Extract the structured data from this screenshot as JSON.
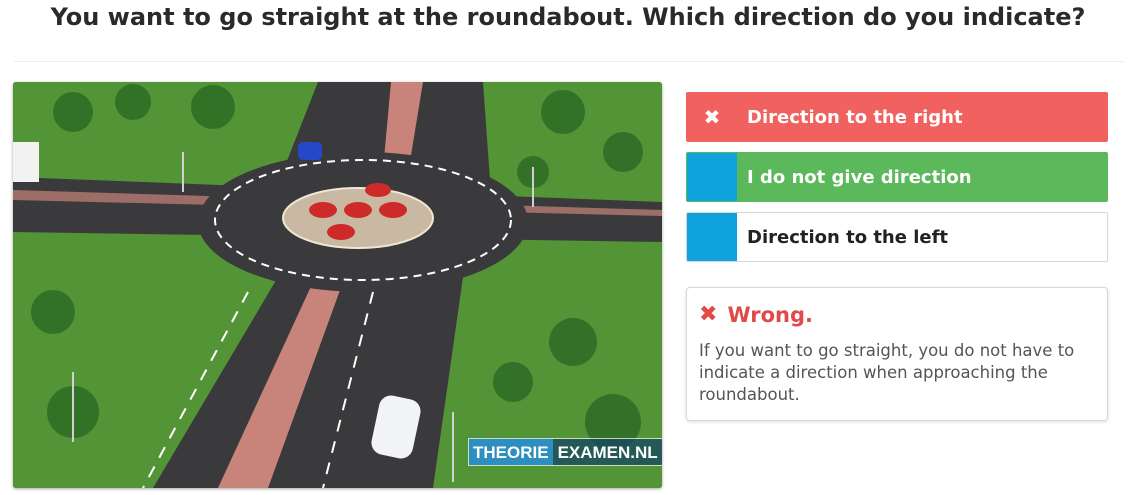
{
  "question": "You want to go straight at the roundabout. Which direction do you indicate?",
  "scene": {
    "watermark_part1": "THEORIE",
    "watermark_part2": "EXAMEN.NL"
  },
  "answers": [
    {
      "label": "Direction to the right",
      "state": "selected-wrong",
      "mark": "✖",
      "icon": "close-icon"
    },
    {
      "label": "I do not give direction",
      "state": "correct",
      "mark": "",
      "icon": "none"
    },
    {
      "label": "Direction to the left",
      "state": "neutral",
      "mark": "",
      "icon": "none"
    }
  ],
  "feedback": {
    "icon": "close-icon",
    "mark": "✖",
    "title": "Wrong.",
    "text": "If you want to go straight, you do not have to indicate a direction when approaching the roundabout."
  },
  "colors": {
    "wrong": "#f06160",
    "correct": "#5bb85b",
    "indicator": "#0fa2dc",
    "feedback_title": "#e04b48"
  }
}
